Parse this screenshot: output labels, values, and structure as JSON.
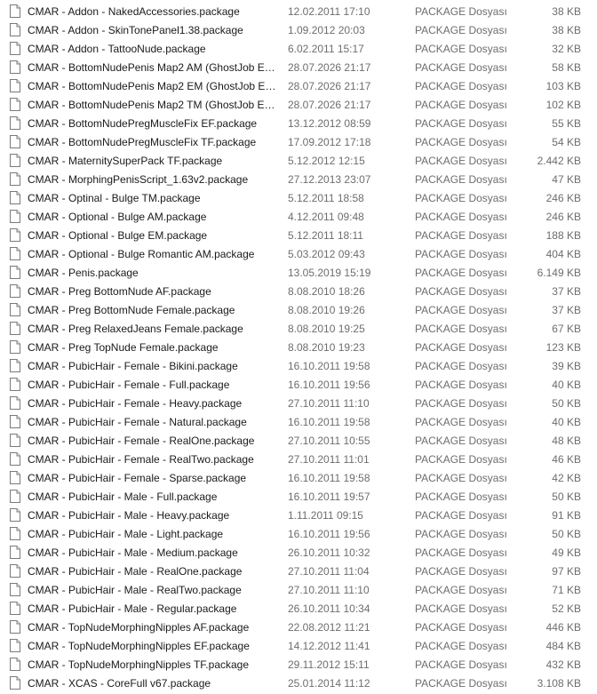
{
  "files": [
    {
      "name": "CMAR - Addon - NakedAccessories.package",
      "date": "12.02.2011 17:10",
      "type": "PACKAGE Dosyası",
      "size": "38 KB"
    },
    {
      "name": "CMAR - Addon - SkinTonePanel1.38.package",
      "date": "1.09.2012 20:03",
      "type": "PACKAGE Dosyası",
      "size": "38 KB"
    },
    {
      "name": "CMAR - Addon - TattooNude.package",
      "date": "6.02.2011 15:17",
      "type": "PACKAGE Dosyası",
      "size": "32 KB"
    },
    {
      "name": "CMAR - BottomNudePenis Map2 AM (GhostJob Ed...",
      "date": "28.07.2026 21:17",
      "type": "PACKAGE Dosyası",
      "size": "58 KB"
    },
    {
      "name": "CMAR - BottomNudePenis Map2 EM (GhostJob Edi...",
      "date": "28.07.2026 21:17",
      "type": "PACKAGE Dosyası",
      "size": "103 KB"
    },
    {
      "name": "CMAR - BottomNudePenis Map2 TM (GhostJob Edi...",
      "date": "28.07.2026 21:17",
      "type": "PACKAGE Dosyası",
      "size": "102 KB"
    },
    {
      "name": "CMAR - BottomNudePregMuscleFix EF.package",
      "date": "13.12.2012 08:59",
      "type": "PACKAGE Dosyası",
      "size": "55 KB"
    },
    {
      "name": "CMAR - BottomNudePregMuscleFix TF.package",
      "date": "17.09.2012 17:18",
      "type": "PACKAGE Dosyası",
      "size": "54 KB"
    },
    {
      "name": "CMAR - MaternitySuperPack TF.package",
      "date": "5.12.2012 12:15",
      "type": "PACKAGE Dosyası",
      "size": "2.442 KB"
    },
    {
      "name": "CMAR - MorphingPenisScript_1.63v2.package",
      "date": "27.12.2013 23:07",
      "type": "PACKAGE Dosyası",
      "size": "47 KB"
    },
    {
      "name": "CMAR - Optinal - Bulge TM.package",
      "date": "5.12.2011 18:58",
      "type": "PACKAGE Dosyası",
      "size": "246 KB"
    },
    {
      "name": "CMAR - Optional - Bulge AM.package",
      "date": "4.12.2011 09:48",
      "type": "PACKAGE Dosyası",
      "size": "246 KB"
    },
    {
      "name": "CMAR - Optional - Bulge EM.package",
      "date": "5.12.2011 18:11",
      "type": "PACKAGE Dosyası",
      "size": "188 KB"
    },
    {
      "name": "CMAR - Optional - Bulge Romantic AM.package",
      "date": "5.03.2012 09:43",
      "type": "PACKAGE Dosyası",
      "size": "404 KB"
    },
    {
      "name": "CMAR - Penis.package",
      "date": "13.05.2019 15:19",
      "type": "PACKAGE Dosyası",
      "size": "6.149 KB"
    },
    {
      "name": "CMAR - Preg BottomNude AF.package",
      "date": "8.08.2010 18:26",
      "type": "PACKAGE Dosyası",
      "size": "37 KB"
    },
    {
      "name": "CMAR - Preg BottomNude Female.package",
      "date": "8.08.2010 19:26",
      "type": "PACKAGE Dosyası",
      "size": "37 KB"
    },
    {
      "name": "CMAR - Preg RelaxedJeans Female.package",
      "date": "8.08.2010 19:25",
      "type": "PACKAGE Dosyası",
      "size": "67 KB"
    },
    {
      "name": "CMAR - Preg TopNude Female.package",
      "date": "8.08.2010 19:23",
      "type": "PACKAGE Dosyası",
      "size": "123 KB"
    },
    {
      "name": "CMAR - PubicHair - Female - Bikini.package",
      "date": "16.10.2011 19:58",
      "type": "PACKAGE Dosyası",
      "size": "39 KB"
    },
    {
      "name": "CMAR - PubicHair - Female - Full.package",
      "date": "16.10.2011 19:56",
      "type": "PACKAGE Dosyası",
      "size": "40 KB"
    },
    {
      "name": "CMAR - PubicHair - Female - Heavy.package",
      "date": "27.10.2011 11:10",
      "type": "PACKAGE Dosyası",
      "size": "50 KB"
    },
    {
      "name": "CMAR - PubicHair - Female - Natural.package",
      "date": "16.10.2011 19:58",
      "type": "PACKAGE Dosyası",
      "size": "40 KB"
    },
    {
      "name": "CMAR - PubicHair - Female - RealOne.package",
      "date": "27.10.2011 10:55",
      "type": "PACKAGE Dosyası",
      "size": "48 KB"
    },
    {
      "name": "CMAR - PubicHair - Female - RealTwo.package",
      "date": "27.10.2011 11:01",
      "type": "PACKAGE Dosyası",
      "size": "46 KB"
    },
    {
      "name": "CMAR - PubicHair - Female - Sparse.package",
      "date": "16.10.2011 19:58",
      "type": "PACKAGE Dosyası",
      "size": "42 KB"
    },
    {
      "name": "CMAR - PubicHair - Male - Full.package",
      "date": "16.10.2011 19:57",
      "type": "PACKAGE Dosyası",
      "size": "50 KB"
    },
    {
      "name": "CMAR - PubicHair - Male - Heavy.package",
      "date": "1.11.2011 09:15",
      "type": "PACKAGE Dosyası",
      "size": "91 KB"
    },
    {
      "name": "CMAR - PubicHair - Male - Light.package",
      "date": "16.10.2011 19:56",
      "type": "PACKAGE Dosyası",
      "size": "50 KB"
    },
    {
      "name": "CMAR - PubicHair - Male - Medium.package",
      "date": "26.10.2011 10:32",
      "type": "PACKAGE Dosyası",
      "size": "49 KB"
    },
    {
      "name": "CMAR - PubicHair - Male - RealOne.package",
      "date": "27.10.2011 11:04",
      "type": "PACKAGE Dosyası",
      "size": "97 KB"
    },
    {
      "name": "CMAR - PubicHair - Male - RealTwo.package",
      "date": "27.10.2011 11:10",
      "type": "PACKAGE Dosyası",
      "size": "71 KB"
    },
    {
      "name": "CMAR - PubicHair - Male - Regular.package",
      "date": "26.10.2011 10:34",
      "type": "PACKAGE Dosyası",
      "size": "52 KB"
    },
    {
      "name": "CMAR - TopNudeMorphingNipples AF.package",
      "date": "22.08.2012 11:21",
      "type": "PACKAGE Dosyası",
      "size": "446 KB"
    },
    {
      "name": "CMAR - TopNudeMorphingNipples EF.package",
      "date": "14.12.2012 11:41",
      "type": "PACKAGE Dosyası",
      "size": "484 KB"
    },
    {
      "name": "CMAR - TopNudeMorphingNipples TF.package",
      "date": "29.11.2012 15:11",
      "type": "PACKAGE Dosyası",
      "size": "432 KB"
    },
    {
      "name": "CMAR - XCAS - CoreFull v67.package",
      "date": "25.01.2014 11:12",
      "type": "PACKAGE Dosyası",
      "size": "3.108 KB"
    }
  ],
  "icon": "generic-file-icon"
}
